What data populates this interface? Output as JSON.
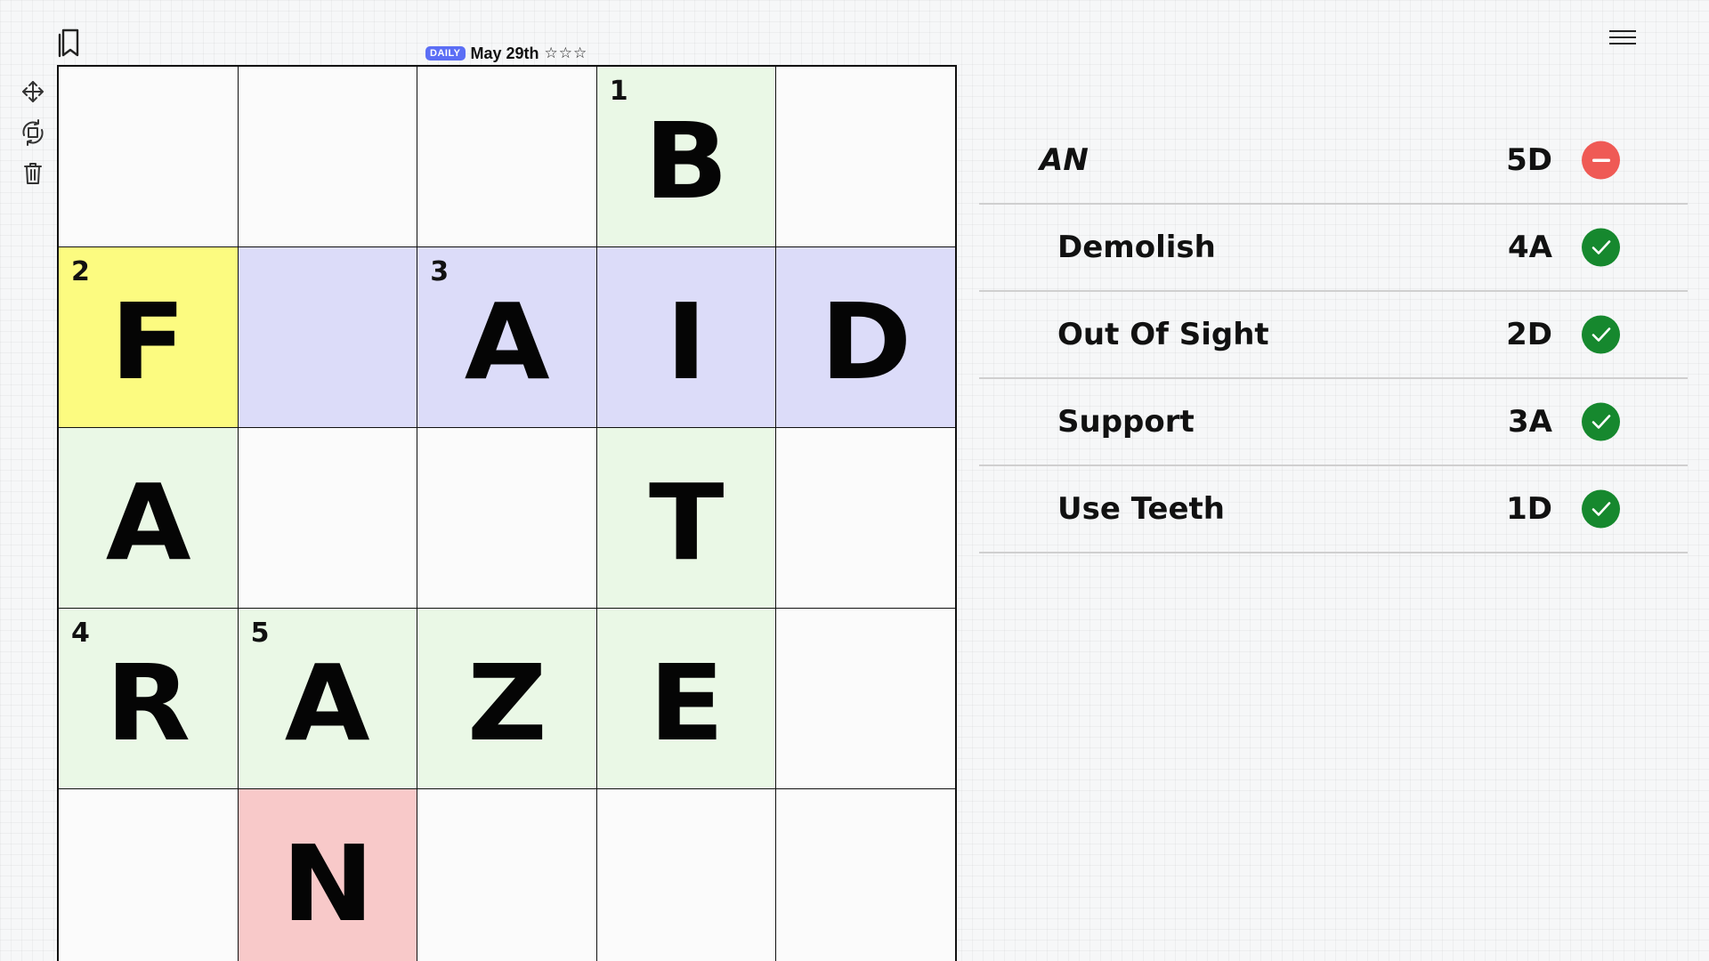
{
  "header": {
    "badge": "DAILY",
    "date": "May 29th",
    "stars": "☆☆☆"
  },
  "colors": {
    "green_cell": "#eaf8e6",
    "purple_cell": "#dcdcf9",
    "yellow_cell": "#fcfb80",
    "red_cell": "#f8c9c9",
    "ok": "#16882e",
    "bad": "#ef5a55",
    "badge": "#5b6ef5"
  },
  "toolbar": {
    "icons": [
      "bookmark-icon",
      "move-icon",
      "rotate-icon",
      "trash-icon",
      "menu-icon"
    ]
  },
  "grid": {
    "rows": [
      [
        {
          "letter": "",
          "num": "",
          "color": "white"
        },
        {
          "letter": "",
          "num": "",
          "color": "white"
        },
        {
          "letter": "",
          "num": "",
          "color": "white"
        },
        {
          "letter": "B",
          "num": "1",
          "color": "green"
        },
        {
          "letter": "",
          "num": "",
          "color": "white"
        }
      ],
      [
        {
          "letter": "F",
          "num": "2",
          "color": "yellow"
        },
        {
          "letter": "",
          "num": "",
          "color": "purple"
        },
        {
          "letter": "A",
          "num": "3",
          "color": "purple"
        },
        {
          "letter": "I",
          "num": "",
          "color": "purple"
        },
        {
          "letter": "D",
          "num": "",
          "color": "purple"
        }
      ],
      [
        {
          "letter": "A",
          "num": "",
          "color": "green"
        },
        {
          "letter": "",
          "num": "",
          "color": "white"
        },
        {
          "letter": "",
          "num": "",
          "color": "white"
        },
        {
          "letter": "T",
          "num": "",
          "color": "green"
        },
        {
          "letter": "",
          "num": "",
          "color": "white"
        }
      ],
      [
        {
          "letter": "R",
          "num": "4",
          "color": "green"
        },
        {
          "letter": "A",
          "num": "5",
          "color": "green"
        },
        {
          "letter": "Z",
          "num": "",
          "color": "green"
        },
        {
          "letter": "E",
          "num": "",
          "color": "green"
        },
        {
          "letter": "",
          "num": "",
          "color": "white"
        }
      ],
      [
        {
          "letter": "",
          "num": "",
          "color": "white"
        },
        {
          "letter": "N",
          "num": "",
          "color": "red"
        },
        {
          "letter": "",
          "num": "",
          "color": "white"
        },
        {
          "letter": "",
          "num": "",
          "color": "white"
        },
        {
          "letter": "",
          "num": "",
          "color": "white"
        }
      ]
    ]
  },
  "clues": [
    {
      "text": "AN",
      "code": "5D",
      "status": "wrong",
      "current": true
    },
    {
      "text": "Demolish",
      "code": "4A",
      "status": "correct",
      "current": false
    },
    {
      "text": "Out Of Sight",
      "code": "2D",
      "status": "correct",
      "current": false
    },
    {
      "text": "Support",
      "code": "3A",
      "status": "correct",
      "current": false
    },
    {
      "text": "Use Teeth",
      "code": "1D",
      "status": "correct",
      "current": false
    }
  ]
}
